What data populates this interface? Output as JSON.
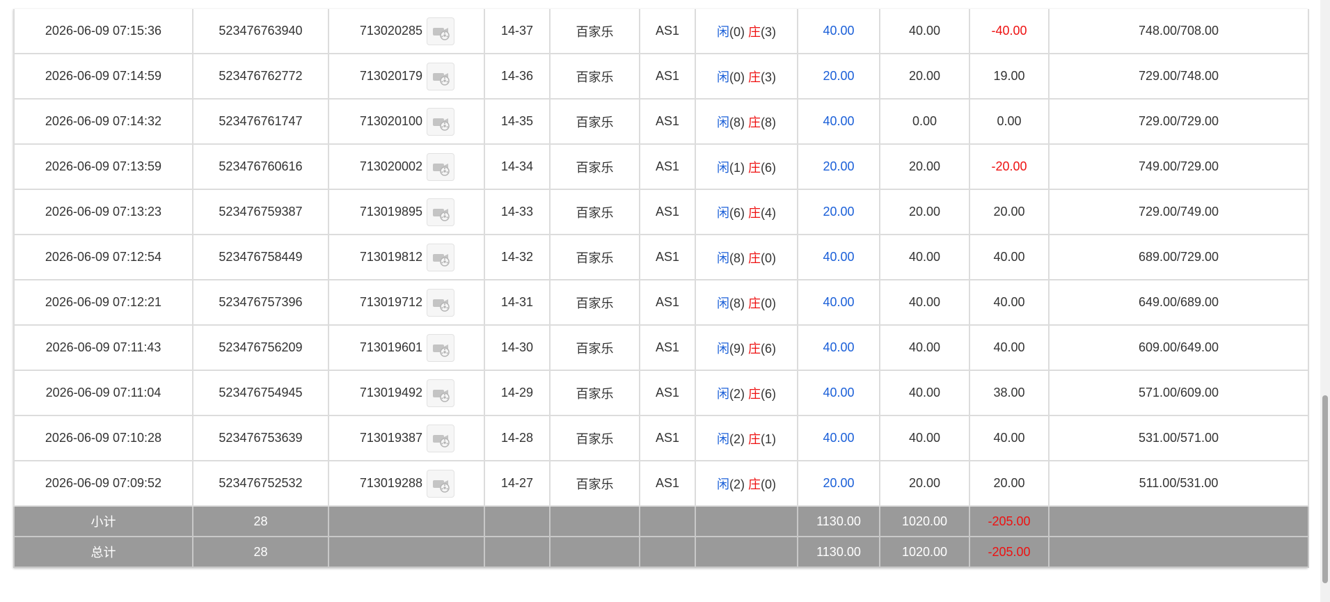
{
  "rows": [
    {
      "time": "2026-06-09 07:15:36",
      "order": "523476763940",
      "game_id": "713020285",
      "shoe": "14-37",
      "game": "百家乐",
      "table": "AS1",
      "xian_label": "闲",
      "xian_val": "(0)",
      "zhuang_label": "庄",
      "zhuang_val": "(3)",
      "bet": "40.00",
      "valid": "40.00",
      "win": "-40.00",
      "win_neg": true,
      "balance": "748.00/708.00"
    },
    {
      "time": "2026-06-09 07:14:59",
      "order": "523476762772",
      "game_id": "713020179",
      "shoe": "14-36",
      "game": "百家乐",
      "table": "AS1",
      "xian_label": "闲",
      "xian_val": "(0)",
      "zhuang_label": "庄",
      "zhuang_val": "(3)",
      "bet": "20.00",
      "valid": "20.00",
      "win": "19.00",
      "win_neg": false,
      "balance": "729.00/748.00"
    },
    {
      "time": "2026-06-09 07:14:32",
      "order": "523476761747",
      "game_id": "713020100",
      "shoe": "14-35",
      "game": "百家乐",
      "table": "AS1",
      "xian_label": "闲",
      "xian_val": "(8)",
      "zhuang_label": "庄",
      "zhuang_val": "(8)",
      "bet": "40.00",
      "valid": "0.00",
      "win": "0.00",
      "win_neg": false,
      "balance": "729.00/729.00"
    },
    {
      "time": "2026-06-09 07:13:59",
      "order": "523476760616",
      "game_id": "713020002",
      "shoe": "14-34",
      "game": "百家乐",
      "table": "AS1",
      "xian_label": "闲",
      "xian_val": "(1)",
      "zhuang_label": "庄",
      "zhuang_val": "(6)",
      "bet": "20.00",
      "valid": "20.00",
      "win": "-20.00",
      "win_neg": true,
      "balance": "749.00/729.00"
    },
    {
      "time": "2026-06-09 07:13:23",
      "order": "523476759387",
      "game_id": "713019895",
      "shoe": "14-33",
      "game": "百家乐",
      "table": "AS1",
      "xian_label": "闲",
      "xian_val": "(6)",
      "zhuang_label": "庄",
      "zhuang_val": "(4)",
      "bet": "20.00",
      "valid": "20.00",
      "win": "20.00",
      "win_neg": false,
      "balance": "729.00/749.00"
    },
    {
      "time": "2026-06-09 07:12:54",
      "order": "523476758449",
      "game_id": "713019812",
      "shoe": "14-32",
      "game": "百家乐",
      "table": "AS1",
      "xian_label": "闲",
      "xian_val": "(8)",
      "zhuang_label": "庄",
      "zhuang_val": "(0)",
      "bet": "40.00",
      "valid": "40.00",
      "win": "40.00",
      "win_neg": false,
      "balance": "689.00/729.00"
    },
    {
      "time": "2026-06-09 07:12:21",
      "order": "523476757396",
      "game_id": "713019712",
      "shoe": "14-31",
      "game": "百家乐",
      "table": "AS1",
      "xian_label": "闲",
      "xian_val": "(8)",
      "zhuang_label": "庄",
      "zhuang_val": "(0)",
      "bet": "40.00",
      "valid": "40.00",
      "win": "40.00",
      "win_neg": false,
      "balance": "649.00/689.00"
    },
    {
      "time": "2026-06-09 07:11:43",
      "order": "523476756209",
      "game_id": "713019601",
      "shoe": "14-30",
      "game": "百家乐",
      "table": "AS1",
      "xian_label": "闲",
      "xian_val": "(9)",
      "zhuang_label": "庄",
      "zhuang_val": "(6)",
      "bet": "40.00",
      "valid": "40.00",
      "win": "40.00",
      "win_neg": false,
      "balance": "609.00/649.00"
    },
    {
      "time": "2026-06-09 07:11:04",
      "order": "523476754945",
      "game_id": "713019492",
      "shoe": "14-29",
      "game": "百家乐",
      "table": "AS1",
      "xian_label": "闲",
      "xian_val": "(2)",
      "zhuang_label": "庄",
      "zhuang_val": "(6)",
      "bet": "40.00",
      "valid": "40.00",
      "win": "38.00",
      "win_neg": false,
      "balance": "571.00/609.00"
    },
    {
      "time": "2026-06-09 07:10:28",
      "order": "523476753639",
      "game_id": "713019387",
      "shoe": "14-28",
      "game": "百家乐",
      "table": "AS1",
      "xian_label": "闲",
      "xian_val": "(2)",
      "zhuang_label": "庄",
      "zhuang_val": "(1)",
      "bet": "40.00",
      "valid": "40.00",
      "win": "40.00",
      "win_neg": false,
      "balance": "531.00/571.00"
    },
    {
      "time": "2026-06-09 07:09:52",
      "order": "523476752532",
      "game_id": "713019288",
      "shoe": "14-27",
      "game": "百家乐",
      "table": "AS1",
      "xian_label": "闲",
      "xian_val": "(2)",
      "zhuang_label": "庄",
      "zhuang_val": "(0)",
      "bet": "20.00",
      "valid": "20.00",
      "win": "20.00",
      "win_neg": false,
      "balance": "511.00/531.00"
    }
  ],
  "subtotal": {
    "label": "小计",
    "count": "28",
    "bet": "1130.00",
    "valid": "1020.00",
    "win": "-205.00"
  },
  "total": {
    "label": "总计",
    "count": "28",
    "bet": "1130.00",
    "valid": "1020.00",
    "win": "-205.00"
  },
  "colors": {
    "bet_text": "#1a5fd8",
    "negative_text": "#ee1111",
    "summary_bg": "#9a9a9a"
  },
  "icons": {
    "replay": "video-replay-icon"
  }
}
